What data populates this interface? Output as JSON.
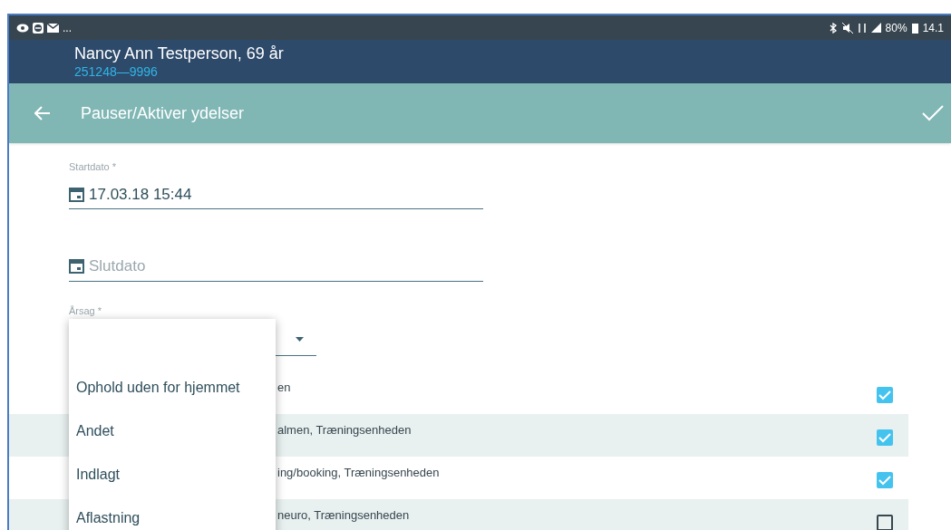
{
  "status_bar": {
    "overflow": "...",
    "battery": "80%",
    "time": "14.1"
  },
  "patient": {
    "name": "Nancy Ann Testperson, 69 år",
    "cpr": "251248—9996"
  },
  "toolbar": {
    "title": "Pauser/Aktiver ydelser"
  },
  "form": {
    "start": {
      "label": "Startdato *",
      "value": "17.03.18 15:44"
    },
    "end": {
      "placeholder": "Slutdato"
    },
    "reason": {
      "label": "Årsag *"
    }
  },
  "rows": [
    {
      "text": "en",
      "checked": true
    },
    {
      "text": "almen, Træningsenheden",
      "checked": true
    },
    {
      "text": "ing/booking, Træningsenheden",
      "checked": true
    },
    {
      "text": "neuro, Træningsenheden",
      "checked": false
    }
  ],
  "menu": {
    "items": [
      {
        "label": "Ophold uden for hjemmet"
      },
      {
        "label": "Andet"
      },
      {
        "label": "Indlagt"
      },
      {
        "label": "Aflastning"
      }
    ]
  }
}
